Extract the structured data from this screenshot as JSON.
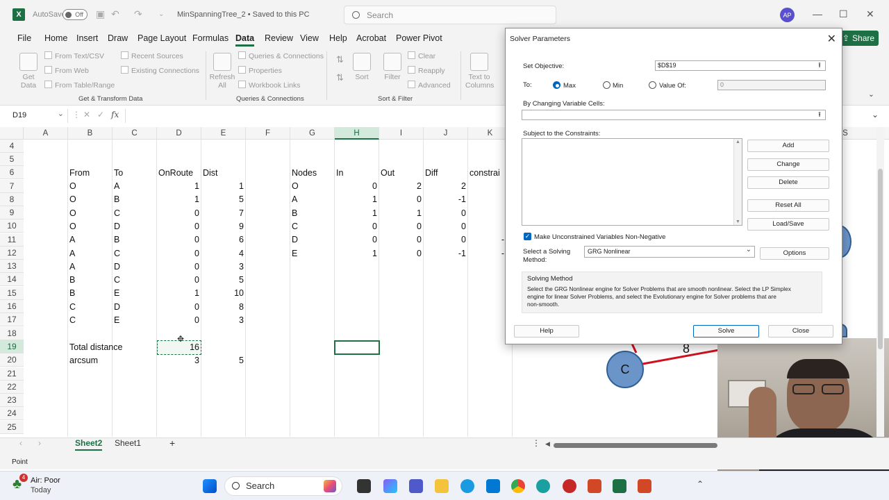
{
  "titlebar": {
    "autosave_label": "AutoSave",
    "autosave_state": "Off",
    "doc_title": "MinSpanningTree_2 • Saved to this PC",
    "search_placeholder": "Search",
    "user_initials": "AP"
  },
  "menu": {
    "items": [
      "File",
      "Home",
      "Insert",
      "Draw",
      "Page Layout",
      "Formulas",
      "Data",
      "Review",
      "View",
      "Help",
      "Acrobat",
      "Power Pivot"
    ],
    "active": "Data",
    "share_label": "Share"
  },
  "ribbon": {
    "get_data": "Get Data",
    "from_text_csv": "From Text/CSV",
    "from_web": "From Web",
    "from_table_range": "From Table/Range",
    "recent_sources": "Recent Sources",
    "existing_connections": "Existing Connections",
    "group_get_transform": "Get & Transform Data",
    "refresh_all": "Refresh All",
    "queries_connections": "Queries & Connections",
    "properties": "Properties",
    "workbook_links": "Workbook Links",
    "group_queries": "Queries & Connections",
    "sort": "Sort",
    "filter": "Filter",
    "clear": "Clear",
    "reapply": "Reapply",
    "advanced": "Advanced",
    "group_sort_filter": "Sort & Filter",
    "text_to_columns": "Text to Columns"
  },
  "formula_bar": {
    "name_box": "D19",
    "fx": "fx"
  },
  "columns": [
    "A",
    "B",
    "C",
    "D",
    "E",
    "F",
    "G",
    "H",
    "I",
    "J",
    "K",
    "S"
  ],
  "rows": [
    "4",
    "5",
    "6",
    "7",
    "8",
    "9",
    "10",
    "11",
    "12",
    "13",
    "14",
    "15",
    "16",
    "17",
    "18",
    "19",
    "20",
    "21",
    "22",
    "23",
    "24",
    "25"
  ],
  "sheet": {
    "headers": {
      "from": "From",
      "to": "To",
      "onroute": "OnRoute",
      "dist": "Dist",
      "nodes": "Nodes",
      "in": "In",
      "out": "Out",
      "diff": "Diff",
      "constraints": "constrai"
    },
    "arcs": [
      {
        "from": "O",
        "to": "A",
        "onroute": "1",
        "dist": "1"
      },
      {
        "from": "O",
        "to": "B",
        "onroute": "1",
        "dist": "5"
      },
      {
        "from": "O",
        "to": "C",
        "onroute": "0",
        "dist": "7"
      },
      {
        "from": "O",
        "to": "D",
        "onroute": "0",
        "dist": "9"
      },
      {
        "from": "A",
        "to": "B",
        "onroute": "0",
        "dist": "6"
      },
      {
        "from": "A",
        "to": "C",
        "onroute": "0",
        "dist": "4"
      },
      {
        "from": "A",
        "to": "D",
        "onroute": "0",
        "dist": "3"
      },
      {
        "from": "B",
        "to": "C",
        "onroute": "0",
        "dist": "5"
      },
      {
        "from": "B",
        "to": "E",
        "onroute": "1",
        "dist": "10"
      },
      {
        "from": "C",
        "to": "D",
        "onroute": "0",
        "dist": "8"
      },
      {
        "from": "C",
        "to": "E",
        "onroute": "0",
        "dist": "3"
      }
    ],
    "nodes": [
      {
        "node": "O",
        "in": "0",
        "out": "2",
        "diff": "2"
      },
      {
        "node": "A",
        "in": "1",
        "out": "0",
        "diff": "-1"
      },
      {
        "node": "B",
        "in": "1",
        "out": "1",
        "diff": "0"
      },
      {
        "node": "C",
        "in": "0",
        "out": "0",
        "diff": "0"
      },
      {
        "node": "D",
        "in": "0",
        "out": "0",
        "diff": "0"
      },
      {
        "node": "E",
        "in": "1",
        "out": "0",
        "diff": "-1"
      }
    ],
    "k_partial": [
      "-",
      "-"
    ],
    "total_label": "Total distance",
    "total_value": "16",
    "arcsum_label": "arcsum",
    "arcsum_d": "3",
    "arcsum_e": "5"
  },
  "graph": {
    "node_c": "C",
    "edge_label": "8"
  },
  "solver": {
    "title": "Solver Parameters",
    "set_objective_label": "Set Objective:",
    "objective_value": "$D$19",
    "to_label": "To:",
    "max_label": "Max",
    "min_label": "Min",
    "valueof_label": "Value Of:",
    "valueof_value": "0",
    "changing_label": "By Changing Variable Cells:",
    "changing_value": "",
    "constraints_label": "Subject to the Constraints:",
    "btn_add": "Add",
    "btn_change": "Change",
    "btn_delete": "Delete",
    "btn_reset": "Reset All",
    "btn_loadsave": "Load/Save",
    "nonneg_label": "Make Unconstrained Variables Non-Negative",
    "method_label_1": "Select a Solving",
    "method_label_2": "Method:",
    "method_value": "GRG Nonlinear",
    "btn_options": "Options",
    "method_heading": "Solving Method",
    "method_desc_1": "Select the GRG Nonlinear engine for Solver Problems that are smooth nonlinear. Select the LP Simplex",
    "method_desc_2": "engine for linear Solver Problems, and select the Evolutionary engine for Solver problems that are",
    "method_desc_3": "non-smooth.",
    "btn_help": "Help",
    "btn_solve": "Solve",
    "btn_close": "Close"
  },
  "tabs": {
    "sheet2": "Sheet2",
    "sheet1": "Sheet1",
    "add": "+"
  },
  "status": {
    "mode": "Point"
  },
  "taskbar": {
    "weather_title": "Air: Poor",
    "weather_sub": "Today",
    "weather_badge": "4",
    "search": "Search"
  }
}
